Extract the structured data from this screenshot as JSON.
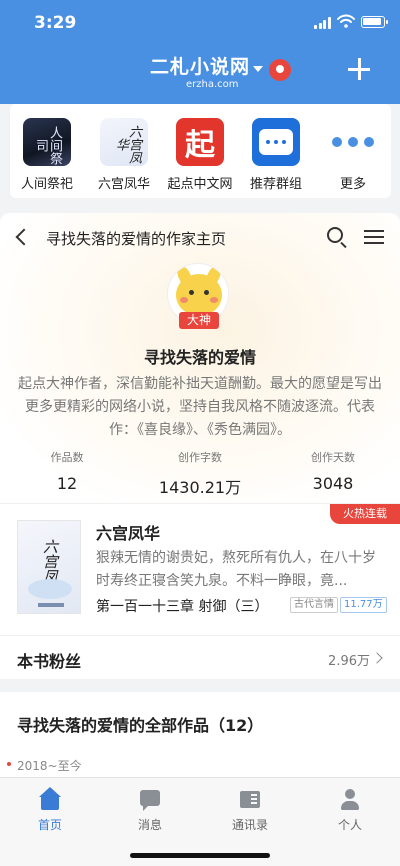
{
  "status_bar": {
    "time": "3:29"
  },
  "header": {
    "title": "二札小说网",
    "subtitle": "erzha.com"
  },
  "quick_apps": [
    {
      "label": "人间祭祀",
      "icon": "book-cover-icon",
      "icon_text": "人间祭司"
    },
    {
      "label": "六宫凤华",
      "icon": "book-cover-icon",
      "icon_text": "六宫凤华"
    },
    {
      "label": "起点中文网",
      "icon": "qidian-logo-icon",
      "icon_text": "起"
    },
    {
      "label": "推荐群组",
      "icon": "chat-bubble-icon"
    },
    {
      "label": "更多",
      "icon": "more-dots-icon"
    }
  ],
  "author_page": {
    "nav_title": "寻找失落的爱情的作家主页",
    "badge": "大神",
    "name": "寻找失落的爱情",
    "bio": "起点大神作者，深信勤能补拙天道酬勤。最大的愿望是写出更多更精彩的网络小说，坚持自我风格不随波逐流。代表作：《喜良缘》、《秀色满园》。",
    "stats": [
      {
        "label": "作品数",
        "value": "12"
      },
      {
        "label": "创作字数",
        "value": "1430.21万"
      },
      {
        "label": "创作天数",
        "value": "3048"
      }
    ]
  },
  "book": {
    "hot_tag": "火热连载",
    "cover_text": "六宫凤华",
    "title": "六宫凤华",
    "description": "狠辣无情的谢贵妃，熬死所有仇人，在八十岁时寿终正寝含笑九泉。不料一睁眼，竟...",
    "latest_chapter": "第一百一十三章 射御（三）",
    "genre": "古代言情",
    "word_count": "11.77万"
  },
  "fans": {
    "label": "本书粉丝",
    "count": "2.96万"
  },
  "works": {
    "title": "寻找失落的爱情的全部作品（12）",
    "year_range": "2018~至今"
  },
  "tabbar": [
    {
      "label": "首页",
      "icon": "home-icon",
      "active": true
    },
    {
      "label": "消息",
      "icon": "message-icon",
      "active": false
    },
    {
      "label": "通讯录",
      "icon": "contacts-icon",
      "active": false
    },
    {
      "label": "个人",
      "icon": "person-icon",
      "active": false
    }
  ],
  "colors": {
    "brand_blue": "#4a90e2",
    "accent_red": "#e8463c",
    "tab_active": "#3a7bd5"
  }
}
